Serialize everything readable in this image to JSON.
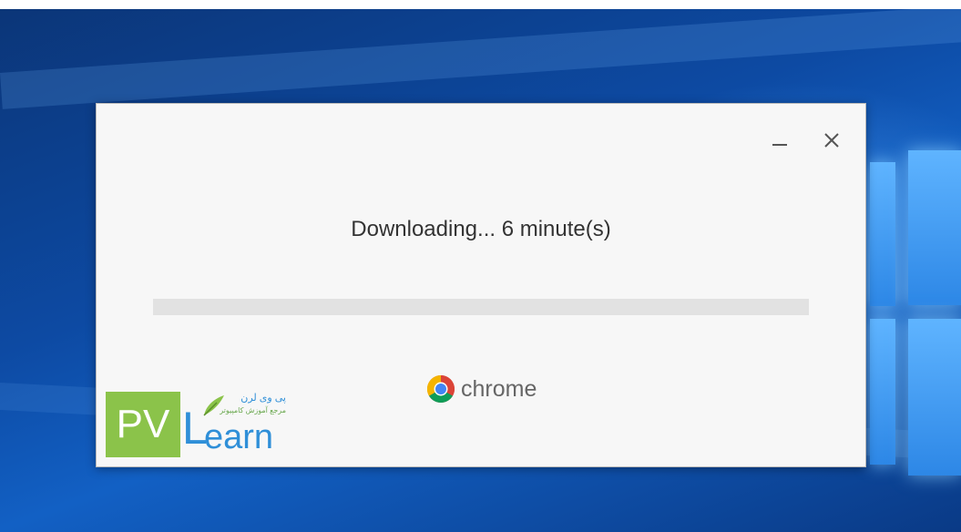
{
  "installer": {
    "status_text": "Downloading... 6 minute(s)",
    "progress_fraction": 0.0,
    "brand_name": "chrome"
  },
  "window_controls": {
    "minimize_icon": "minimize-icon",
    "close_icon": "close-icon"
  },
  "watermark": {
    "logo_text_pv": "PV",
    "logo_text_l": "L",
    "logo_text_earn": "earn",
    "tagline_fa": "پی وی لرن",
    "subtitle_fa": "مرجع آموزش کامپیوتر"
  },
  "colors": {
    "dialog_background": "#f7f7f7",
    "progress_track": "#e2e2e2",
    "status_text": "#333333",
    "watermark_green": "#8bc34a",
    "watermark_blue": "#2f8fd8"
  }
}
